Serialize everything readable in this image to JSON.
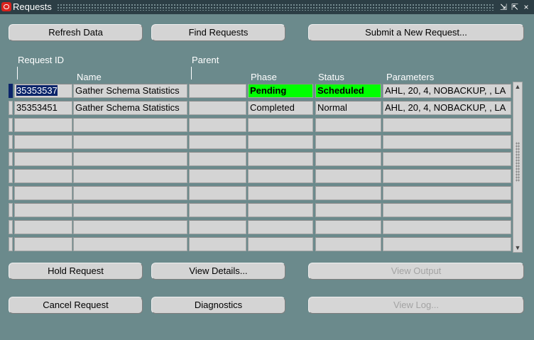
{
  "window": {
    "title": "Requests",
    "controls": {
      "minimize": "⇲",
      "maximize": "⇱",
      "close": "×"
    }
  },
  "buttons": {
    "refresh": "Refresh Data",
    "find": "Find Requests",
    "submit": "Submit a New Request...",
    "hold": "Hold Request",
    "view_details": "View Details...",
    "view_output": "View Output",
    "cancel": "Cancel Request",
    "diagnostics": "Diagnostics",
    "view_log": "View Log..."
  },
  "table": {
    "headers": {
      "request_id": "Request ID",
      "parent": "Parent",
      "name": "Name",
      "phase": "Phase",
      "status": "Status",
      "parameters": "Parameters"
    },
    "rows": [
      {
        "id": "35353537",
        "name": "Gather Schema Statistics",
        "parent": "",
        "phase": "Pending",
        "status": "Scheduled",
        "parameters": "AHL, 20, 4, NOBACKUP, , LA"
      },
      {
        "id": "35353451",
        "name": "Gather Schema Statistics",
        "parent": "",
        "phase": "Completed",
        "status": "Normal",
        "parameters": "AHL, 20, 4, NOBACKUP, , LA"
      }
    ],
    "highlight_color": "#00ff00",
    "selection_color": "#0a246a"
  }
}
